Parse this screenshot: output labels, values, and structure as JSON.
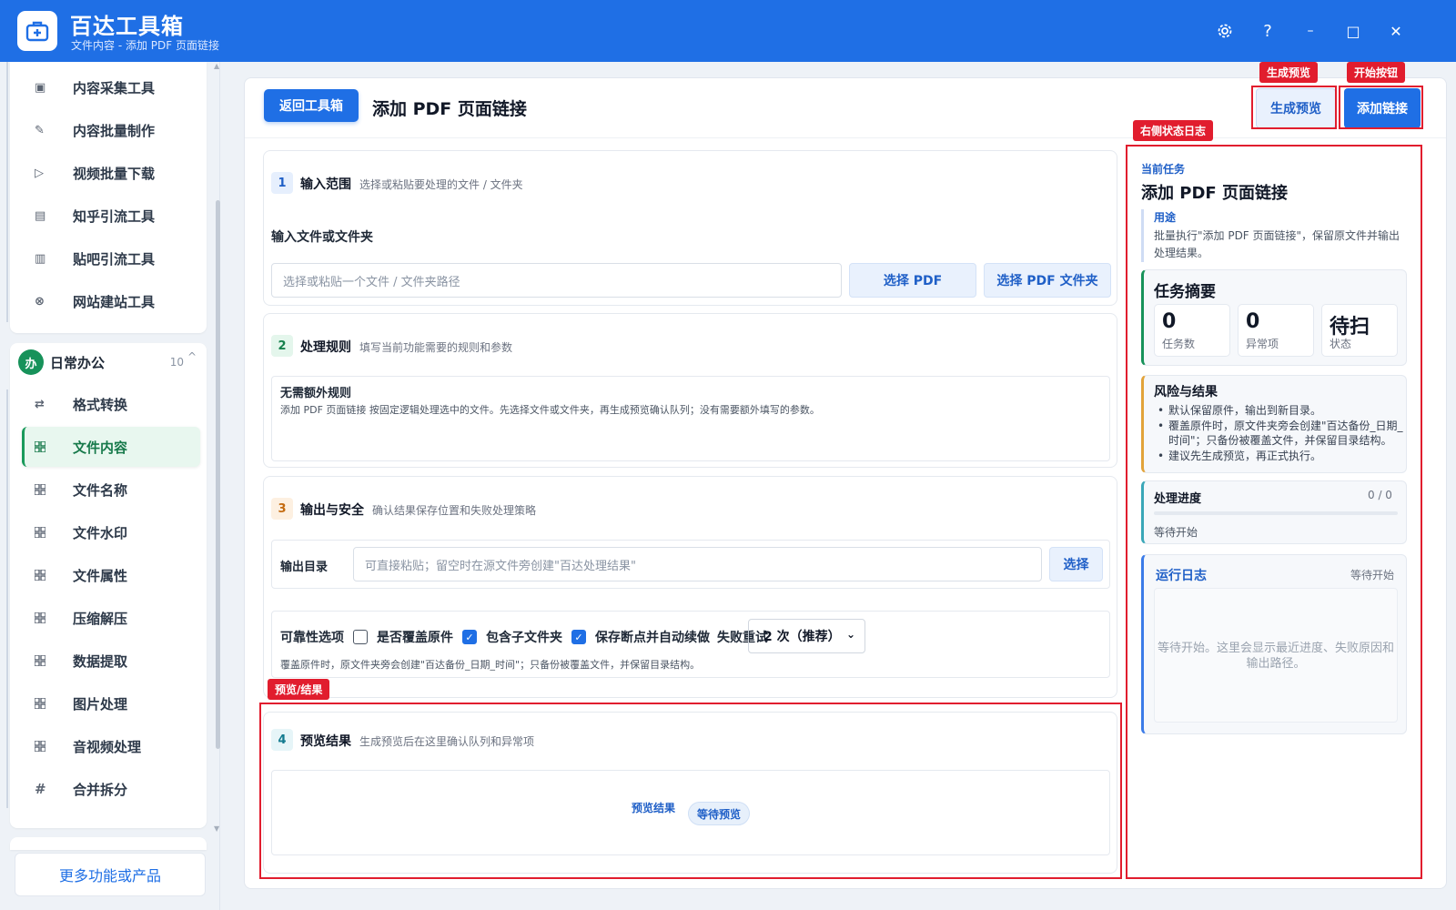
{
  "app": {
    "title": "百达工具箱",
    "subtitle": "文件内容 - 添加 PDF 页面链接"
  },
  "window_controls": {
    "settings_icon": "gear-icon",
    "help": "?",
    "minimize": "–",
    "maximize": "□",
    "close": "✕"
  },
  "sidebar": {
    "top_items": [
      {
        "label": "内容采集工具",
        "icon": "collect-icon"
      },
      {
        "label": "内容批量制作",
        "icon": "pen-icon"
      },
      {
        "label": "视频批量下载",
        "icon": "video-icon"
      },
      {
        "label": "知乎引流工具",
        "icon": "zhihu-icon"
      },
      {
        "label": "贴吧引流工具",
        "icon": "tieba-icon"
      },
      {
        "label": "网站建站工具",
        "icon": "globe-icon"
      }
    ],
    "group": {
      "badge": "办",
      "title": "日常办公",
      "count": "10",
      "caret": "^"
    },
    "group_items": [
      {
        "label": "格式转换",
        "icon": "swap-icon"
      },
      {
        "label": "文件内容",
        "icon": "grid-icon",
        "active": true
      },
      {
        "label": "文件名称",
        "icon": "grid-icon"
      },
      {
        "label": "文件水印",
        "icon": "grid-icon"
      },
      {
        "label": "文件属性",
        "icon": "grid-icon"
      },
      {
        "label": "压缩解压",
        "icon": "grid-icon"
      },
      {
        "label": "数据提取",
        "icon": "grid-icon"
      },
      {
        "label": "图片处理",
        "icon": "grid-icon"
      },
      {
        "label": "音视频处理",
        "icon": "grid-icon"
      },
      {
        "label": "合并拆分",
        "icon": "hash-icon"
      }
    ],
    "more_button": "更多功能或产品"
  },
  "header": {
    "back_button": "返回工具箱",
    "page_title": "添加 PDF 页面链接",
    "preview_button": "生成预览",
    "start_button": "添加链接"
  },
  "sections": {
    "input": {
      "num": "1",
      "title": "输入范围",
      "desc": "选择或粘贴要处理的文件 / 文件夹",
      "field_label": "输入文件或文件夹",
      "placeholder": "选择或粘贴一个文件 / 文件夹路径",
      "pick_pdf": "选择 PDF",
      "pick_folder": "选择 PDF 文件夹"
    },
    "rules": {
      "num": "2",
      "title": "处理规则",
      "desc": "填写当前功能需要的规则和参数",
      "box_title": "无需额外规则",
      "box_text": "添加 PDF 页面链接 按固定逻辑处理选中的文件。先选择文件或文件夹，再生成预览确认队列；没有需要额外填写的参数。"
    },
    "output": {
      "num": "3",
      "title": "输出与安全",
      "desc": "确认结果保存位置和失败处理策略",
      "dir_label": "输出目录",
      "dir_placeholder": "可直接粘贴；留空时在源文件旁创建\"百达处理结果\"",
      "choose": "选择",
      "options_label": "可靠性选项",
      "overwrite_label": "是否覆盖原件",
      "overwrite_checked": false,
      "subfolders_label": "包含子文件夹",
      "subfolders_checked": true,
      "resume_label": "保存断点并自动续做",
      "resume_checked": true,
      "retry_label": "失败重试",
      "retry_value": "2 次（推荐）",
      "note": "覆盖原件时，原文件夹旁会创建\"百达备份_日期_时间\"；只备份被覆盖文件，并保留目录结构。"
    },
    "preview": {
      "num": "4",
      "title": "预览结果",
      "desc": "生成预览后在这里确认队列和异常项",
      "result_label": "预览结果",
      "status_chip": "等待预览"
    }
  },
  "annotations": {
    "preview_btn_tag": "生成预览",
    "start_btn_tag": "开始按钮",
    "right_log_tag": "右侧状态日志",
    "preview_result_tag": "预览/结果",
    "color": "#e11d2e"
  },
  "right_panel": {
    "kicker": "当前任务",
    "title": "添加 PDF 页面链接",
    "usage_title": "用途",
    "usage_text": "批量执行\"添加 PDF 页面链接\"，保留原文件并输出处理结果。",
    "summary": {
      "title": "任务摘要",
      "stats": [
        {
          "value": "0",
          "label": "任务数"
        },
        {
          "value": "0",
          "label": "异常项"
        },
        {
          "value": "待扫",
          "label": "状态"
        }
      ]
    },
    "risk": {
      "title": "风险与结果",
      "items": [
        "默认保留原件，输出到新目录。",
        "覆盖原件时，原文件夹旁会创建\"百达备份_日期_时间\"；只备份被覆盖文件，并保留目录结构。",
        "建议先生成预览，再正式执行。"
      ]
    },
    "progress": {
      "title": "处理进度",
      "count": "0 / 0",
      "fraction": 0,
      "status": "等待开始"
    },
    "log": {
      "title": "运行日志",
      "status": "等待开始",
      "placeholder": "等待开始。这里会显示最近进度、失败原因和输出路径。"
    }
  },
  "colors": {
    "primary": "#1f6fe5",
    "active_green": "#17925a",
    "annotation_red": "#e11d2e"
  }
}
